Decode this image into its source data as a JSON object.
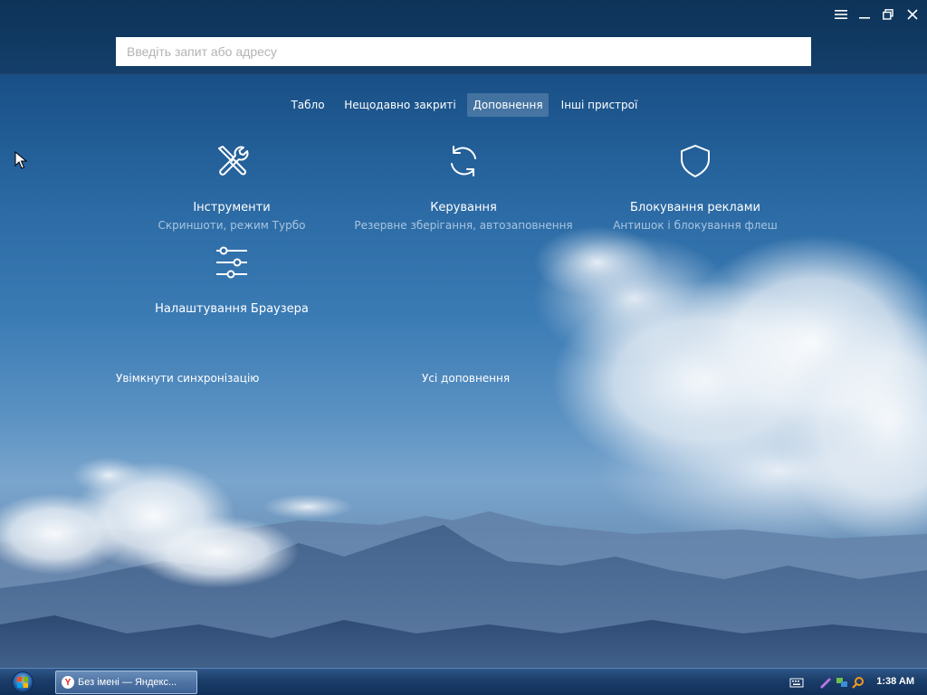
{
  "browser": {
    "omnibox_placeholder": "Введіть запит або адресу",
    "window_controls": [
      "menu-icon",
      "minimize-icon",
      "restore-icon",
      "close-icon"
    ]
  },
  "tabs": [
    {
      "label": "Табло",
      "active": false
    },
    {
      "label": "Нещодавно закриті",
      "active": false
    },
    {
      "label": "Доповнення",
      "active": true
    },
    {
      "label": "Інші пристрої",
      "active": false
    }
  ],
  "addons": {
    "tools": {
      "icon": "wrench-screwdriver-icon",
      "title": "Інструменти",
      "subtitle": "Скриншоти, режим Турбо"
    },
    "manage": {
      "icon": "sync-icon",
      "title": "Керування",
      "subtitle": "Резервне зберігання, автозаповнення"
    },
    "adblock": {
      "icon": "shield-icon",
      "title": "Блокування реклами",
      "subtitle": "Антишок і блокування флеш"
    },
    "settings": {
      "icon": "sliders-icon",
      "title": "Налаштування Браузера"
    }
  },
  "links": {
    "sync": "Увімкнути синхронізацію",
    "all_addons": "Усі доповнення"
  },
  "taskbar": {
    "task_label": "Без імені — Яндекс...",
    "task_icon_letter": "Y",
    "clock": "1:38 AM"
  },
  "colors": {
    "topbar": "#0d3358",
    "active_tab": "rgba(255,255,255,0.18)",
    "yandex_red": "#e1261c"
  }
}
